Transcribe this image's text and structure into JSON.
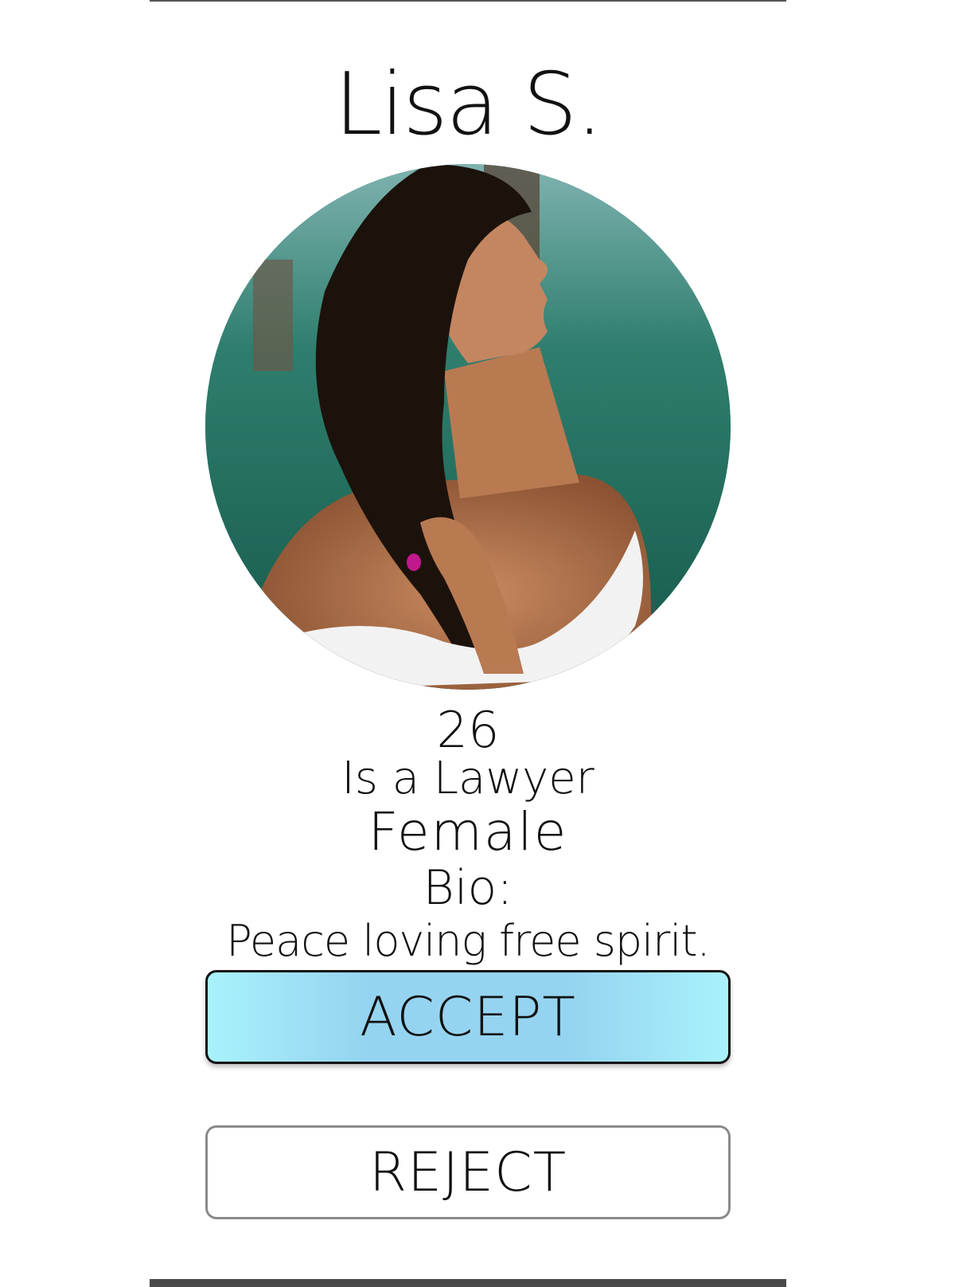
{
  "profile": {
    "name": "Lisa S.",
    "age": "26",
    "occupation": "Is a Lawyer",
    "gender": "Female",
    "bio_label": "Bio:",
    "bio_text": "Peace loving free spirit."
  },
  "actions": {
    "accept_label": "ACCEPT",
    "reject_label": "REJECT"
  },
  "colors": {
    "accept_gradient_edge": "#a9f2fc",
    "accept_gradient_center": "#95d4f0",
    "photo_water": "#1f6b5a"
  }
}
